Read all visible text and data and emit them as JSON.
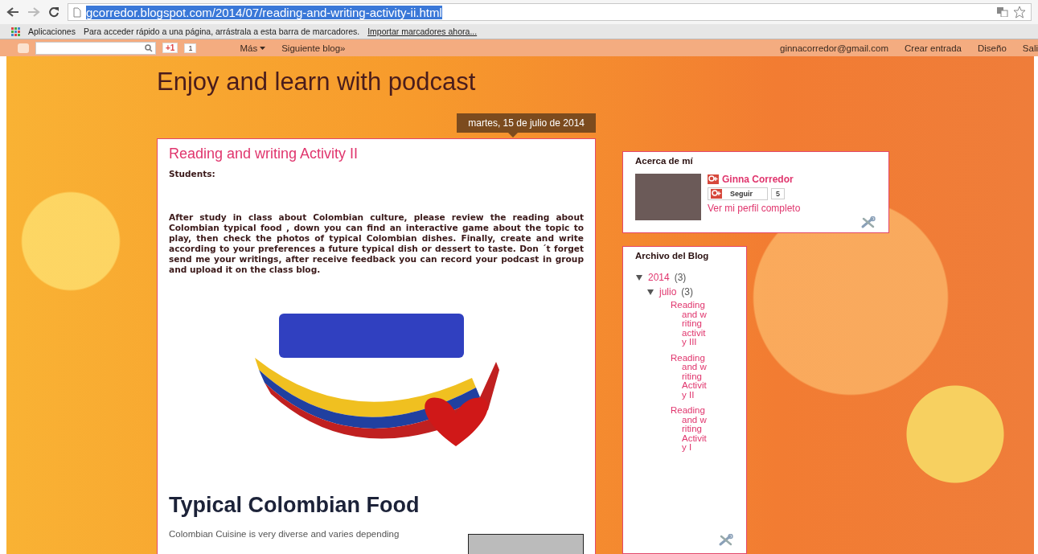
{
  "browser": {
    "url": "gcorredor.blogspot.com/2014/07/reading-and-writing-activity-ii.html",
    "url_highlighted": true
  },
  "bookmarks_bar": {
    "apps_label": "Aplicaciones",
    "hint": "Para acceder rápido a una página, arrástrala a esta barra de marcadores.",
    "import_link": "Importar marcadores ahora..."
  },
  "navbar": {
    "plus_one": "+1",
    "plus_one_count": "1",
    "more": "Más",
    "next_blog": "Siguiente blog»",
    "email": "ginnacorredor@gmail.com",
    "links": [
      "Crear entrada",
      "Diseño",
      "Sali"
    ]
  },
  "blog": {
    "title": "Enjoy and learn with podcast"
  },
  "post": {
    "date": "martes, 15 de julio de 2014",
    "title": "Reading and writing Activity II",
    "greeting": "Students:",
    "body": "After study in class about Colombian culture, please review the reading about Colombian typical food , down you can find an interactive game about the topic to play, then check the photos of typical Colombian dishes. Finally, create and write according to your preferences a future typical dish or dessert to taste. Don ´t forget send me your writings, after receive feedback you can record your podcast in group and upload it on the class blog.",
    "heading": "Typical Colombian Food",
    "intro": "Colombian Cuisine is very diverse and varies depending"
  },
  "about": {
    "title": "Acerca de mí",
    "name": "Ginna Corredor",
    "follow": "Seguir",
    "followers": "5",
    "profile_link": "Ver mi perfil completo"
  },
  "archive": {
    "title": "Archivo del Blog",
    "items": [
      {
        "label": "2014",
        "count": "(3)",
        "expanded": true,
        "children": [
          {
            "label": "julio",
            "count": "(3)",
            "expanded": true,
            "children": [
              {
                "label": "Reading and writing activity III"
              },
              {
                "label": "Reading and writing Activity II"
              },
              {
                "label": "Reading and writing Activity I"
              }
            ]
          }
        ]
      }
    ]
  }
}
